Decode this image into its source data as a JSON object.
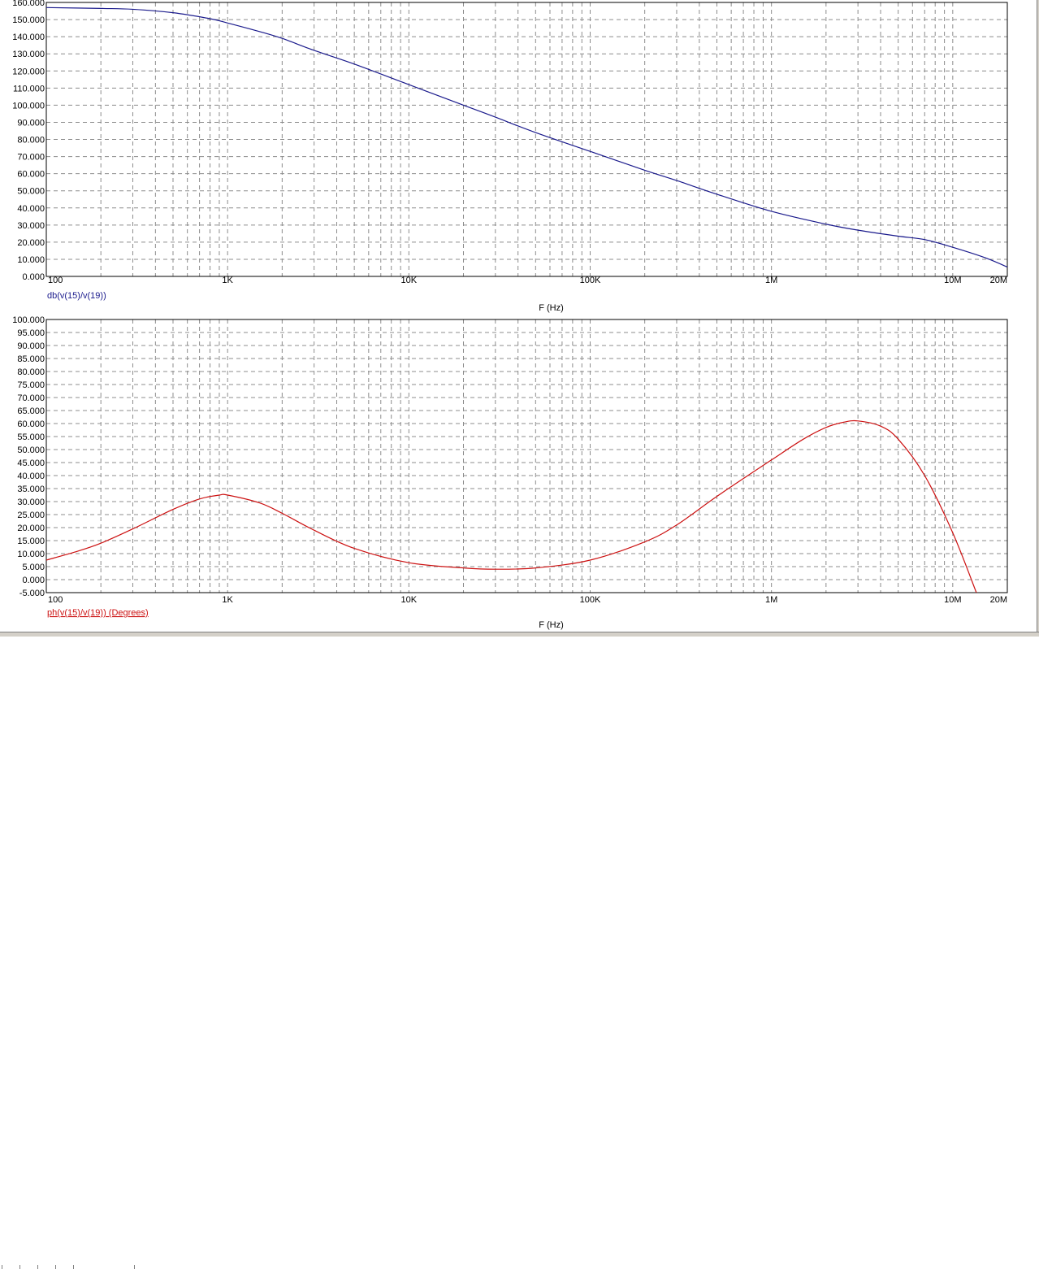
{
  "colors": {
    "magnitude_trace": "#1a1a8c",
    "phase_trace": "#cc1111",
    "grid": "#8c8c8c",
    "axis_text": "#000000"
  },
  "chart_data": [
    {
      "type": "line",
      "x_scale": "log",
      "xlim": [
        100,
        20000000
      ],
      "ylim": [
        0,
        160
      ],
      "grid": true,
      "yticks": [
        "0.000",
        "10.000",
        "20.000",
        "30.000",
        "40.000",
        "50.000",
        "60.000",
        "70.000",
        "80.000",
        "90.000",
        "100.000",
        "110.000",
        "120.000",
        "130.000",
        "140.000",
        "150.000",
        "160.000"
      ],
      "xticks": [
        "100",
        "1K",
        "10K",
        "100K",
        "1M",
        "10M",
        "20M"
      ],
      "xlabel": "F (Hz)",
      "series": [
        {
          "name": "db(v(15)/v(19))",
          "color": "#1a1a8c",
          "x": [
            100,
            200,
            300,
            500,
            800,
            1000,
            1500,
            2000,
            3000,
            5000,
            10000,
            20000,
            30000,
            50000,
            100000,
            200000,
            300000,
            500000,
            1000000,
            2000000,
            3000000,
            5000000,
            7000000,
            10000000,
            15000000,
            20000000
          ],
          "y": [
            157,
            156.5,
            156,
            154,
            150.5,
            148,
            143,
            139,
            132,
            124,
            112,
            100,
            93,
            84,
            73,
            62,
            56,
            48,
            38,
            30.5,
            27,
            23.5,
            21.5,
            17,
            11,
            5.5
          ]
        }
      ]
    },
    {
      "type": "line",
      "x_scale": "log",
      "xlim": [
        100,
        20000000
      ],
      "ylim": [
        -5,
        100
      ],
      "grid": true,
      "yticks": [
        "-5.000",
        "0.000",
        "5.000",
        "10.000",
        "15.000",
        "20.000",
        "25.000",
        "30.000",
        "35.000",
        "40.000",
        "45.000",
        "50.000",
        "55.000",
        "60.000",
        "65.000",
        "70.000",
        "75.000",
        "80.000",
        "85.000",
        "90.000",
        "95.000",
        "100.000"
      ],
      "xticks": [
        "100",
        "1K",
        "10K",
        "100K",
        "1M",
        "10M",
        "20M"
      ],
      "xlabel": "F (Hz)",
      "series": [
        {
          "name": "ph(v(15)/v(19)) (Degrees)",
          "color": "#cc1111",
          "x": [
            100,
            150,
            200,
            300,
            500,
            700,
            900,
            1000,
            1500,
            2000,
            3000,
            5000,
            10000,
            20000,
            30000,
            50000,
            100000,
            200000,
            300000,
            500000,
            1000000,
            1500000,
            2000000,
            2500000,
            3000000,
            4000000,
            5000000,
            7000000,
            10000000,
            13500000
          ],
          "y": [
            7.5,
            11,
            14,
            19.5,
            27,
            31,
            32.5,
            32.5,
            29.5,
            25.5,
            19,
            12,
            6.5,
            4.5,
            4,
            4.5,
            7.5,
            14.5,
            21,
            32,
            46,
            54,
            58.5,
            60.5,
            61,
            59,
            54,
            40,
            18,
            -5
          ]
        }
      ]
    }
  ]
}
